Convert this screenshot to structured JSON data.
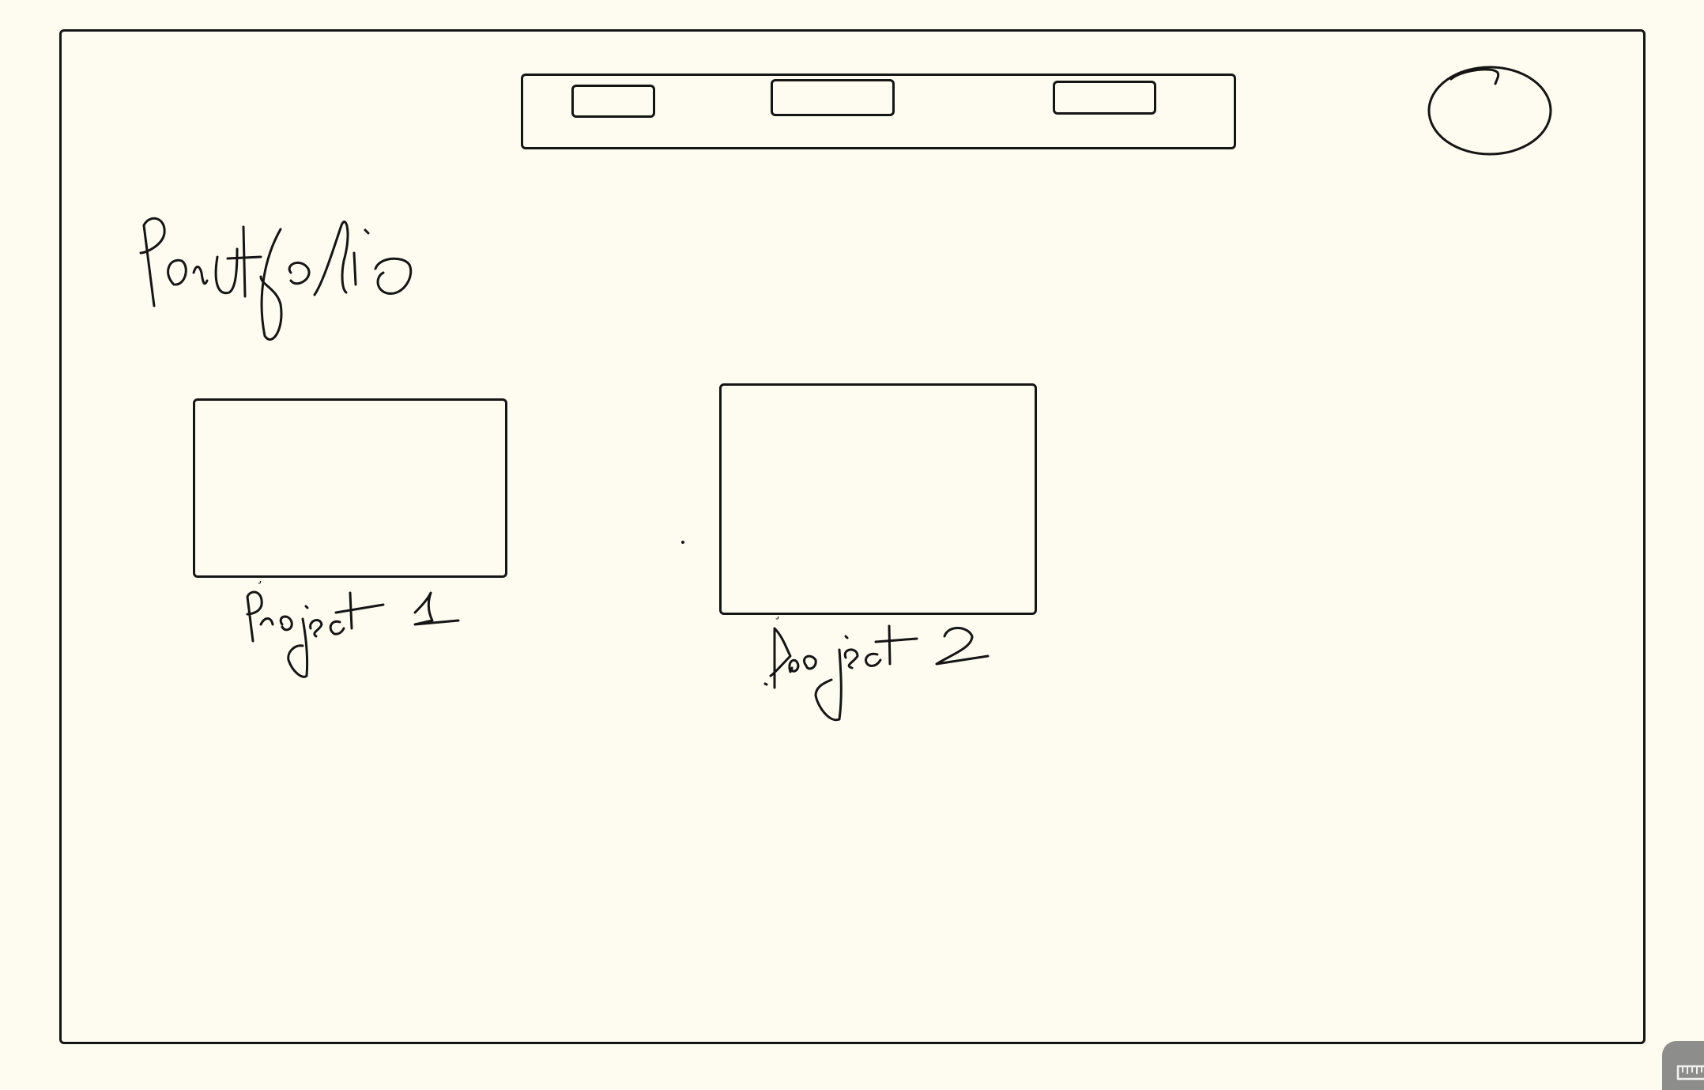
{
  "page": {
    "title": "Portfolio"
  },
  "header": {
    "nav_items": [
      "",
      "",
      ""
    ],
    "avatar_icon": "avatar-circle-icon"
  },
  "projects": [
    {
      "label": "Project 1"
    },
    {
      "label": "Project 2"
    }
  ],
  "toolbar": {
    "ruler_icon": "ruler-icon"
  },
  "colors": {
    "background": "#fefcf0",
    "stroke": "#151515",
    "tool_button": "#8d8d8b"
  }
}
